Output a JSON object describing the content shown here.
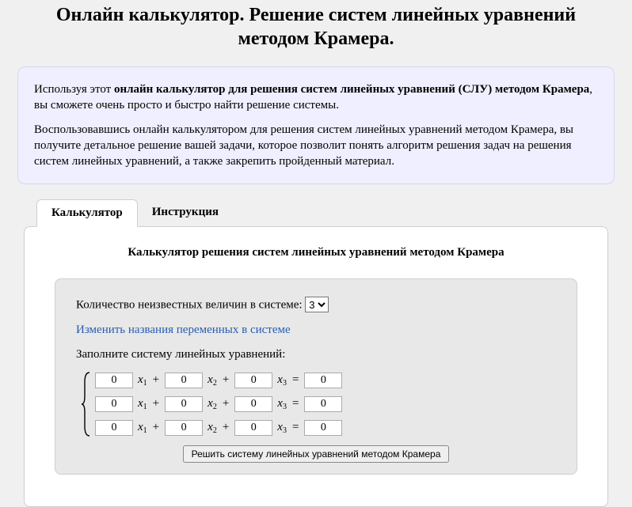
{
  "page_title": "Онлайн калькулятор. Решение систем линейных уравнений методом Крамера.",
  "intro": {
    "p1_prefix": "Используя этот ",
    "p1_bold": "онлайн калькулятор для решения систем линейных уравнений (СЛУ) методом Крамера",
    "p1_suffix": ", вы сможете очень просто и быстро найти решение системы.",
    "p2": "Воспользовавшись онлайн калькулятором для решения систем линейных уравнений методом Крамера, вы получите детальное решение вашей задачи, которое позволит понять алгоритм решения задач на решения систем линейных уравнений, а также закрепить пройденный материал."
  },
  "tabs": {
    "calc": "Калькулятор",
    "instr": "Инструкция"
  },
  "calc": {
    "title": "Калькулятор решения систем линейных уравнений методом Крамера",
    "unknowns_label": "Количество неизвестных величин в системе: ",
    "unknowns_value": "3",
    "rename_link": "Изменить названия переменных в системе",
    "fill_label": "Заполните систему линейных уравнений:",
    "var_base": "x",
    "solve_button": "Решить систему линейных уравнений методом Крамера",
    "rows": [
      {
        "c": [
          "0",
          "0",
          "0"
        ],
        "rhs": "0"
      },
      {
        "c": [
          "0",
          "0",
          "0"
        ],
        "rhs": "0"
      },
      {
        "c": [
          "0",
          "0",
          "0"
        ],
        "rhs": "0"
      }
    ]
  }
}
